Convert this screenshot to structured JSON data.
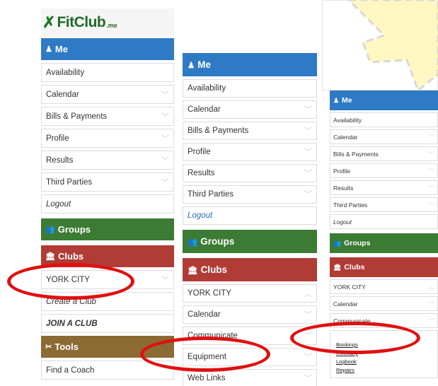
{
  "logo": {
    "name": "FitClub",
    "suffix": ".me"
  },
  "panel_a": {
    "me": "Me",
    "items": [
      "Availability",
      "Calendar",
      "Bills & Payments",
      "Profile",
      "Results",
      "Third Parties"
    ],
    "logout": "Logout",
    "groups": "Groups",
    "clubs": "Clubs",
    "club": "YORK CITY",
    "create": "Create a Club",
    "join": "JOIN A CLUB",
    "tools": "Tools",
    "find": "Find a Coach"
  },
  "panel_b": {
    "me": "Me",
    "items": [
      "Availability",
      "Calendar",
      "Bills & Payments",
      "Profile",
      "Results",
      "Third Parties"
    ],
    "logout": "Logout",
    "groups": "Groups",
    "clubs": "Clubs",
    "club": "YORK CITY",
    "club_items": [
      "Calendar",
      "Communicate",
      "Equipment",
      "Web Links"
    ]
  },
  "panel_c": {
    "me": "Me",
    "items": [
      "Availability",
      "Calendar",
      "Bills & Payments",
      "Profile",
      "Results",
      "Third Parties"
    ],
    "logout": "Logout",
    "groups": "Groups",
    "clubs": "Clubs",
    "club": "YORK CITY",
    "club_items": [
      "Calendar",
      "Communicate"
    ],
    "equipment_sub": [
      "Bookings",
      "Inventory",
      "Logbook",
      "Repairs"
    ]
  },
  "colors": {
    "me": "#2e7ac4",
    "groups": "#3b7b34",
    "clubs": "#b13b35",
    "tools": "#8b6a34",
    "highlight": "#e01010"
  }
}
